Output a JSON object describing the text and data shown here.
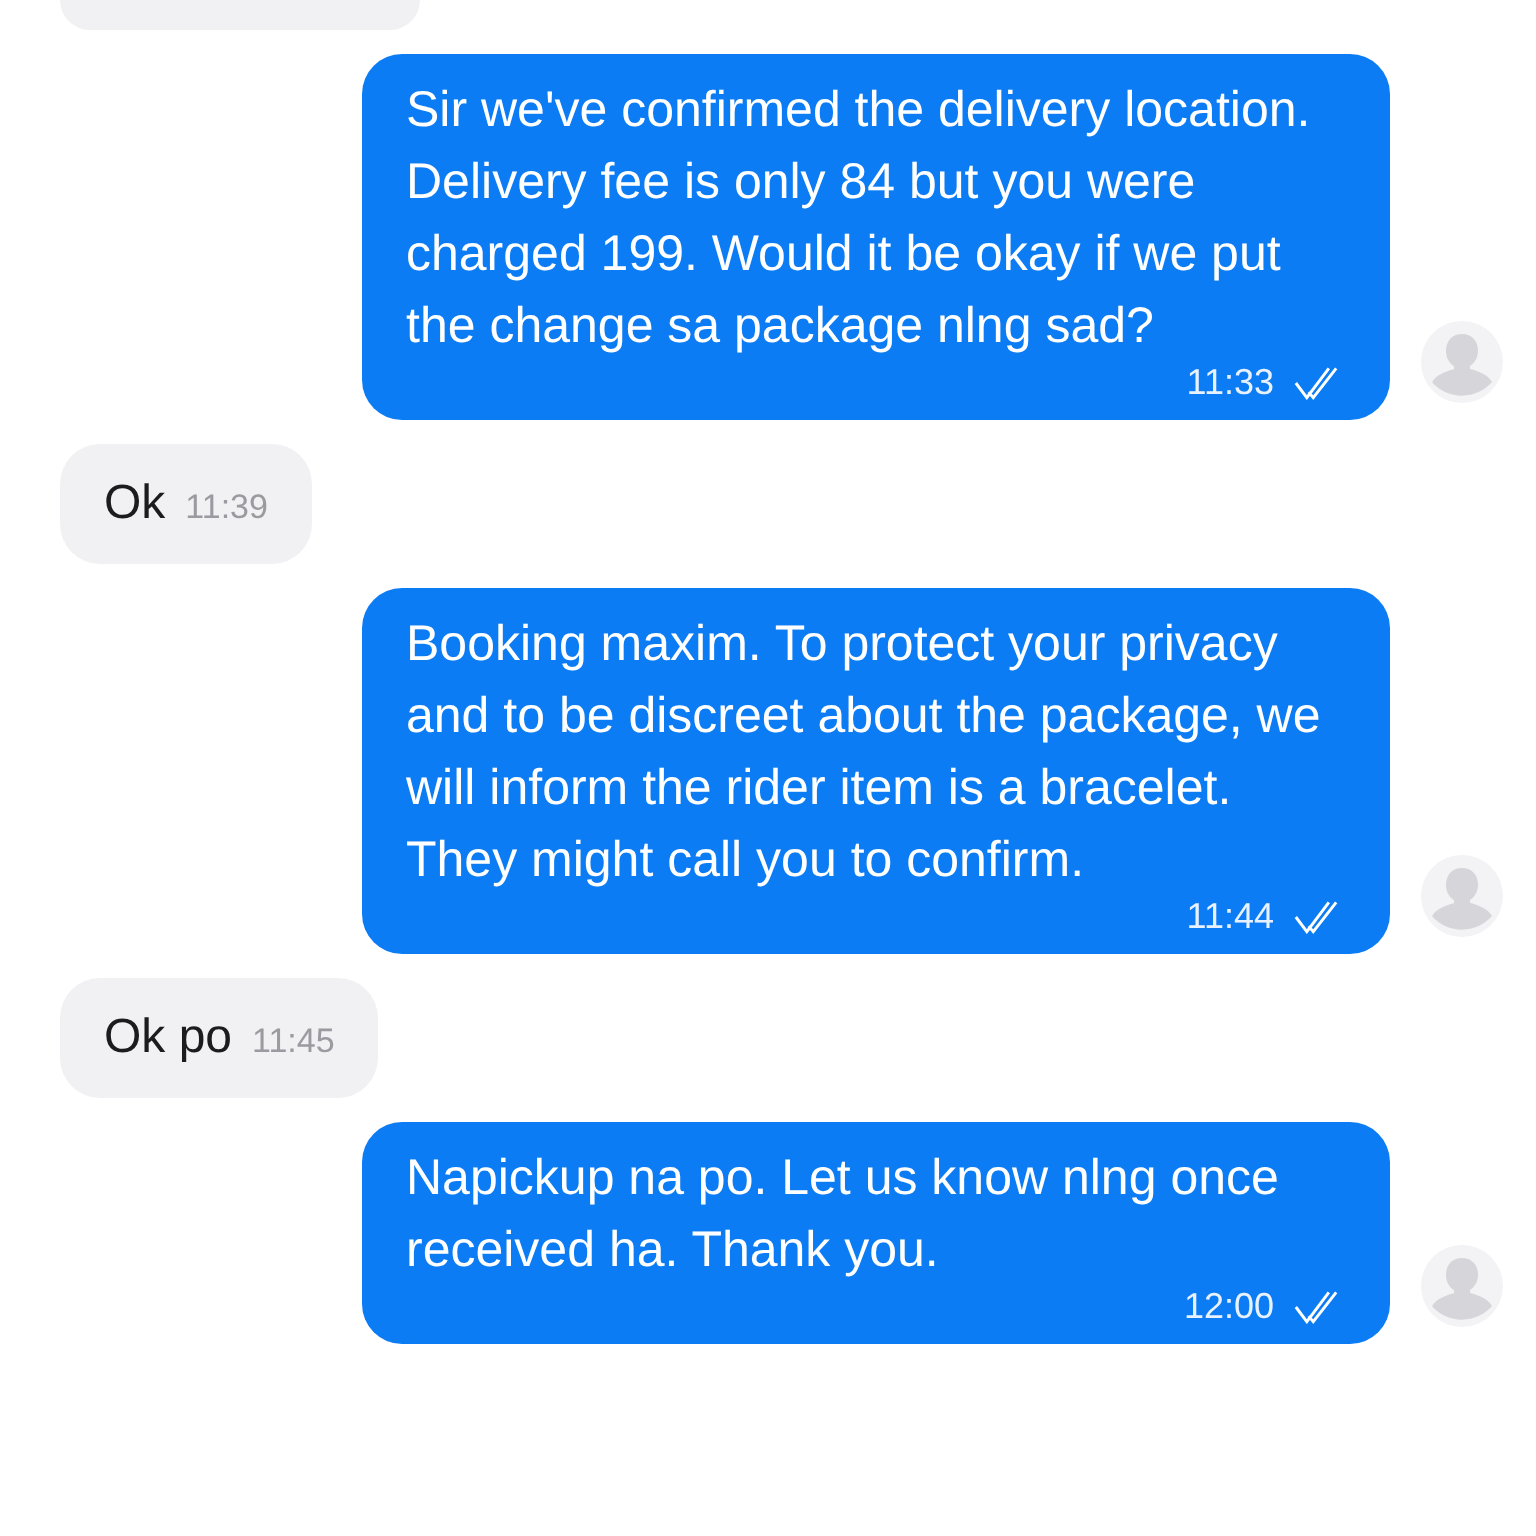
{
  "messages": [
    {
      "kind": "incoming_cut"
    },
    {
      "kind": "outgoing",
      "text": "Sir we've confirmed the delivery location. Delivery fee is only 84 but you were charged 199. Would it be okay if we put the change sa package nlng sad?",
      "time": "11:33",
      "read": true
    },
    {
      "kind": "incoming",
      "text": "Ok",
      "time": "11:39"
    },
    {
      "kind": "outgoing",
      "text": "Booking maxim. To protect your privacy and to be discreet about the package, we will inform the rider item is a bracelet. They might call you to confirm.",
      "time": "11:44",
      "read": true
    },
    {
      "kind": "incoming",
      "text": "Ok po",
      "time": "11:45"
    },
    {
      "kind": "outgoing",
      "text": "Napickup na po. Let us know nlng once received ha. Thank you.",
      "time": "12:00",
      "read": true
    }
  ]
}
